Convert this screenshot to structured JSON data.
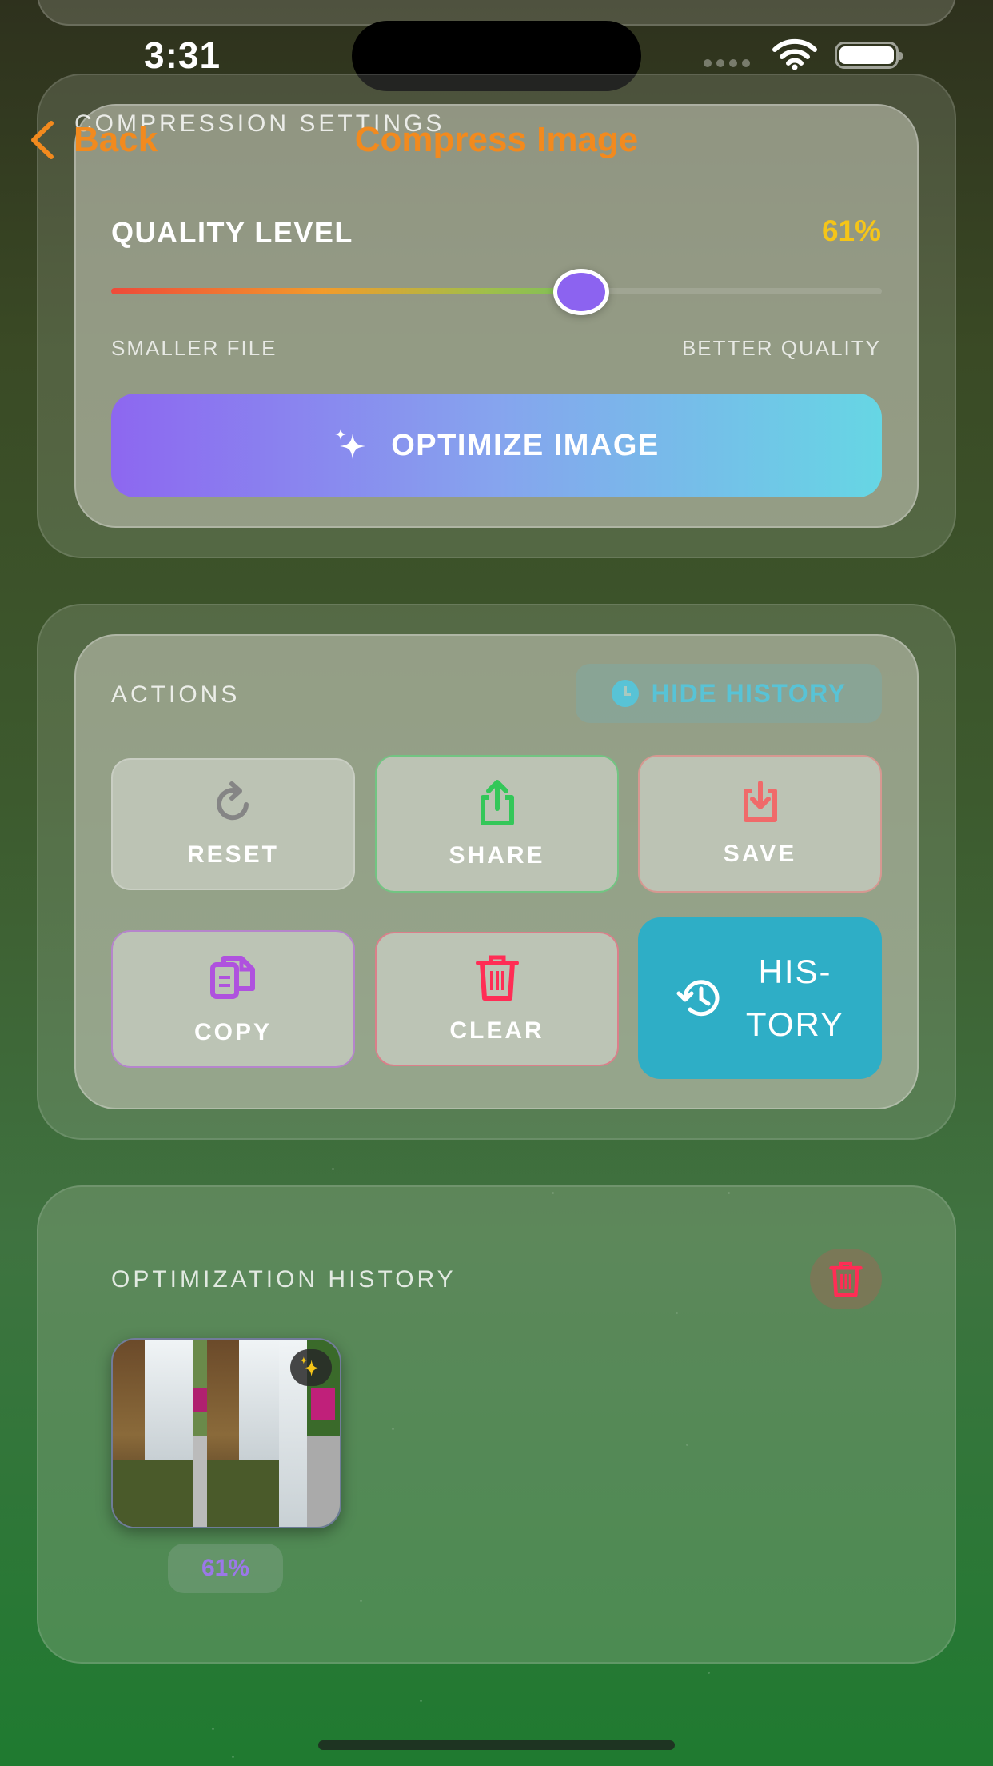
{
  "status_bar": {
    "time": "3:31"
  },
  "nav": {
    "back_label": "Back",
    "title": "Compress Image"
  },
  "compression": {
    "section_label": "COMPRESSION SETTINGS",
    "quality_label": "QUALITY LEVEL",
    "quality_value_text": "61%",
    "quality_fraction": 0.61,
    "min_label": "SMALLER FILE",
    "max_label": "BETTER QUALITY",
    "optimize_label": "OPTIMIZE IMAGE"
  },
  "actions": {
    "section_label": "ACTIONS",
    "hide_history_label": "HIDE HISTORY",
    "buttons": [
      {
        "label": "RESET",
        "icon": "reset-icon",
        "color": "#8a8a8a"
      },
      {
        "label": "SHARE",
        "icon": "share-icon",
        "color": "#34c759"
      },
      {
        "label": "SAVE",
        "icon": "save-icon",
        "color": "#f06a6a"
      },
      {
        "label": "COPY",
        "icon": "copy-icon",
        "color": "#af52de"
      },
      {
        "label": "CLEAR",
        "icon": "trash-icon",
        "color": "#ff2d55"
      }
    ],
    "history_line1": "HIS-",
    "history_line2": "TORY"
  },
  "history": {
    "section_label": "OPTIMIZATION HISTORY",
    "items": [
      {
        "quality_text": "61%"
      }
    ]
  },
  "colors": {
    "accent_orange": "#f28a1e",
    "quality_yellow": "#f5c518",
    "history_teal": "#2eaec6",
    "optimize_gradient_start": "#8d67f0",
    "optimize_gradient_end": "#66d6e4"
  }
}
